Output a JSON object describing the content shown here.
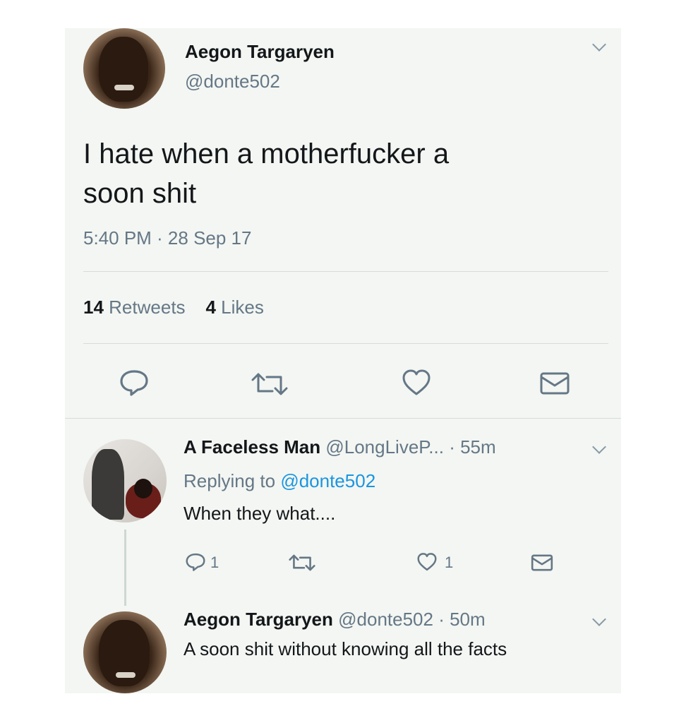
{
  "main_tweet": {
    "display_name": "Aegon Targaryen",
    "handle": "@donte502",
    "text_line1": "I hate when a motherfucker a",
    "text_line2": "soon shit",
    "timestamp": "5:40 PM · 28 Sep 17",
    "retweets_count": "14",
    "retweets_label": "Retweets",
    "likes_count": "4",
    "likes_label": "Likes",
    "icons": [
      "reply-icon",
      "retweet-icon",
      "like-icon",
      "share-icon"
    ]
  },
  "reply_tweet": {
    "display_name": "A Faceless Man",
    "handle": "@LongLiveP...",
    "time": "· 55m",
    "replying_prefix": "Replying to",
    "replying_handle": "@donte502",
    "text": "When they what....",
    "reply_count": "1",
    "like_count": "1"
  },
  "third_tweet": {
    "display_name": "Aegon Targaryen",
    "handle": "@donte502",
    "time": "· 50m",
    "text": "A soon shit without knowing all the facts"
  },
  "colors": {
    "card_background": "#f3f6f2",
    "text": "#14171a",
    "muted": "#657786",
    "link": "#1b95e0"
  }
}
